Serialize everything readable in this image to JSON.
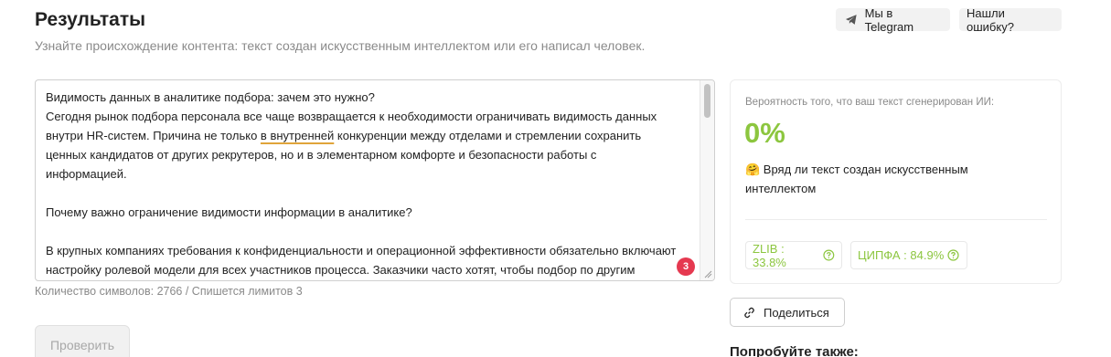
{
  "header": {
    "title": "Результаты",
    "subtitle": "Узнайте происхождение контента: текст создан искусственным интеллектом или его написал человек.",
    "telegram_label": "Мы в Telegram",
    "error_label": "Нашли ошибку?"
  },
  "editor": {
    "lines": [
      "Видимость данных в аналитике подбора: зачем это нужно?",
      "Сегодня рынок подбора персонала все чаще возвращается к необходимости ограничивать видимость данных",
      "",
      "ценных кандидатов от других рекрутеров, но и в элементарном комфорте и безопасности работы с",
      "информацией.",
      "",
      "Почему важно ограничение видимости информации в аналитике?",
      "",
      "В крупных компаниях требования к конфиденциальности и операционной эффективности обязательно включают",
      "настройку ролевой модели для всех участников процесса. Заказчики часто хотят, чтобы подбор по другим"
    ],
    "line3_before": "внутри HR-систем. Причина не только ",
    "line3_underlined": "в внутренней",
    "line3_after": " конкуренции между отделами и стремлении сохранить",
    "issue_count": "3"
  },
  "char_count": "Количество символов: 2766 / Спишется лимитов 3",
  "check_button": "Проверить",
  "result": {
    "probability_label": "Вероятность того, что ваш текст сгенерирован ИИ:",
    "percent": "0%",
    "verdict": "🤗 Вряд ли текст создан искусственным интеллектом",
    "zlib": "ZLIB : 33.8%",
    "cipfa": "ЦИПФА : 84.9%"
  },
  "share_label": "Поделиться",
  "try_also": "Попробуйте также:",
  "colors": {
    "accent_green": "#8cc63f",
    "badge_red": "#e53950"
  },
  "icons": {
    "telegram": "telegram-icon",
    "link": "link-icon",
    "help": "help-circle-icon"
  }
}
